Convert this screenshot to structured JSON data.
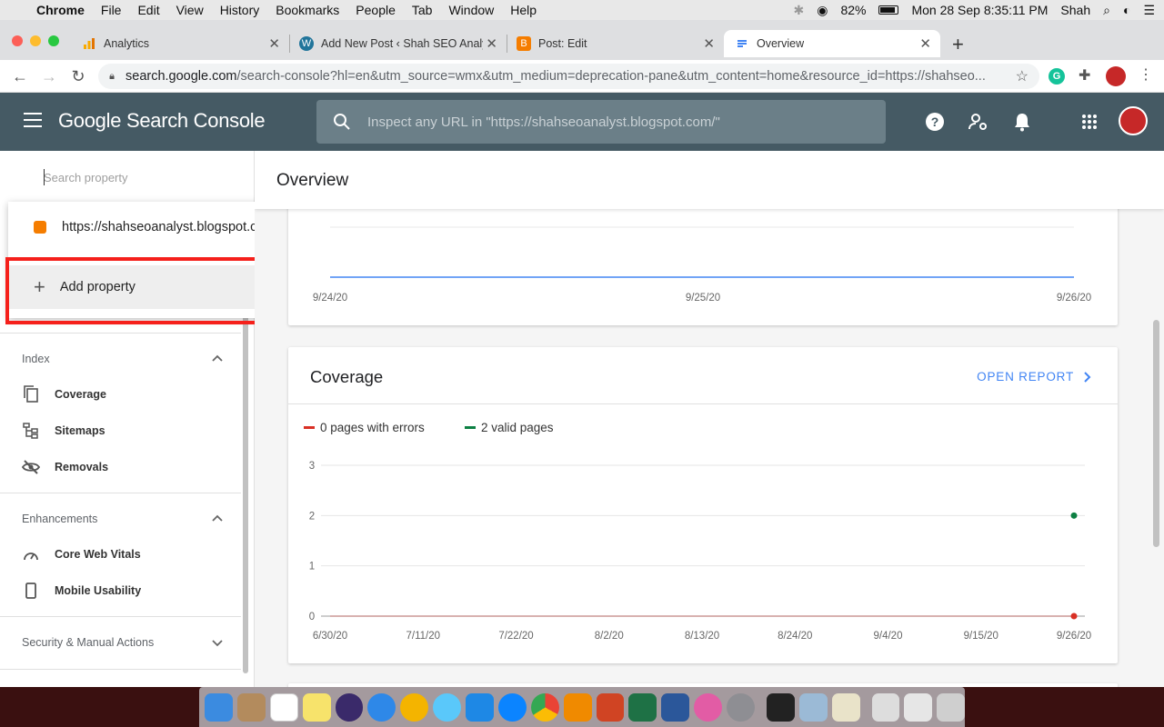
{
  "menubar": {
    "app": "Chrome",
    "items": [
      "File",
      "Edit",
      "View",
      "History",
      "Bookmarks",
      "People",
      "Tab",
      "Window",
      "Help"
    ],
    "battery": "82%",
    "clock": "Mon 28 Sep  8:35:11 PM",
    "user": "Shah"
  },
  "tabs": [
    {
      "title": "Analytics"
    },
    {
      "title": "Add New Post ‹ Shah SEO Analyst"
    },
    {
      "title": "Post: Edit"
    },
    {
      "title": "Overview"
    }
  ],
  "address_bar": {
    "url_host": "search.google.com",
    "url_rest": "/search-console?hl=en&utm_source=wmx&utm_medium=deprecation-pane&utm_content=home&resource_id=https://shahseo..."
  },
  "header": {
    "brand": "Google Search Console",
    "search_placeholder": "Inspect any URL in \"https://shahseoanalyst.blogspot.com/\""
  },
  "sidebar": {
    "search_placeholder": "Search property",
    "property": "https://shahseoanalyst.blogspot.com/",
    "add_property": "Add property",
    "sections": [
      {
        "title": "Index",
        "items": [
          "Coverage",
          "Sitemaps",
          "Removals"
        ]
      },
      {
        "title": "Enhancements",
        "items": [
          "Core Web Vitals",
          "Mobile Usability"
        ]
      },
      {
        "title": "Security & Manual Actions",
        "items": []
      }
    ]
  },
  "main": {
    "page_title": "Overview",
    "top_chart_ticks": [
      "9/24/20",
      "9/25/20",
      "9/26/20"
    ],
    "coverage": {
      "title": "Coverage",
      "open_report": "OPEN REPORT",
      "legend_errors": "0 pages with errors",
      "legend_valid": "2 valid pages"
    }
  },
  "colors": {
    "header_bg": "#455a64",
    "accent_blue": "#4285f4",
    "error_red": "#d93025",
    "valid_green": "#0d8043",
    "highlight_red": "#f5201b"
  },
  "chart_data": {
    "type": "line",
    "title": "",
    "xlabel": "",
    "ylabel": "",
    "ylim": [
      0,
      3
    ],
    "y_ticks": [
      0,
      1,
      2,
      3
    ],
    "x": [
      "6/30/20",
      "7/11/20",
      "7/22/20",
      "8/2/20",
      "8/13/20",
      "8/24/20",
      "9/4/20",
      "9/15/20",
      "9/26/20"
    ],
    "series": [
      {
        "name": "0 pages with errors",
        "color": "#d93025",
        "values": [
          0,
          0,
          0,
          0,
          0,
          0,
          0,
          0,
          0
        ]
      },
      {
        "name": "2 valid pages",
        "color": "#0d8043",
        "values": [
          null,
          null,
          null,
          null,
          null,
          null,
          null,
          null,
          2
        ]
      }
    ],
    "grid": true,
    "legend": "top-left"
  }
}
